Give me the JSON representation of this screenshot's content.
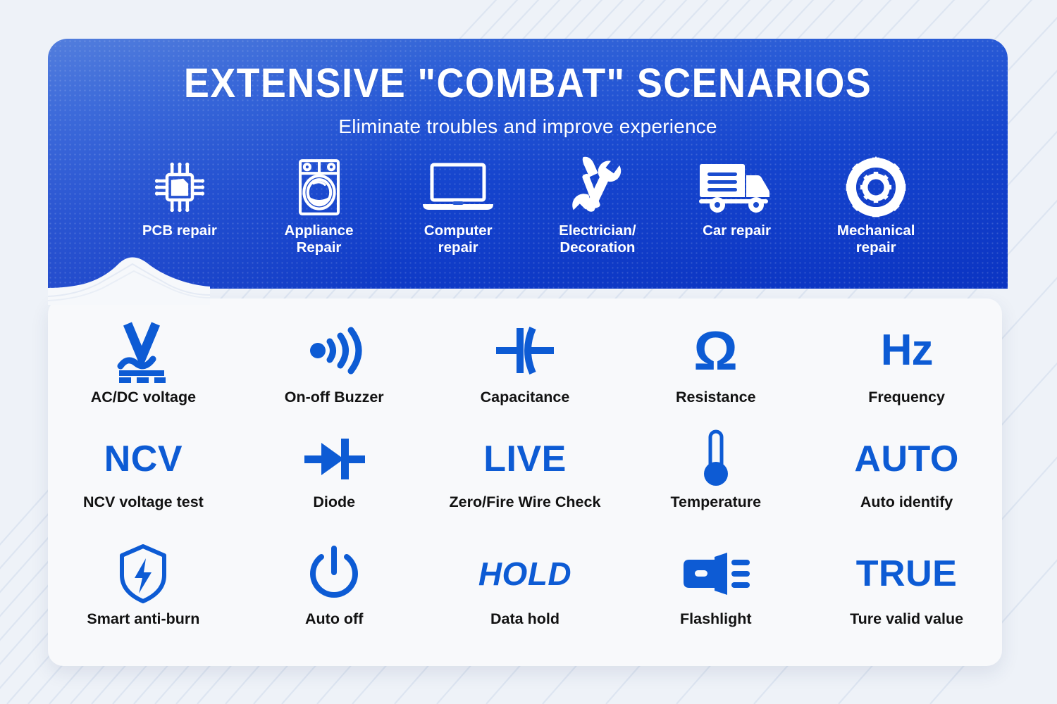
{
  "header": {
    "title": "EXTENSIVE \"COMBAT\" SCENARIOS",
    "subtitle": "Eliminate troubles and improve experience",
    "bg_color_top": "#3f6fd9",
    "bg_color_bottom": "#0b34c2",
    "text_color": "#ffffff",
    "scenarios": [
      {
        "icon": "pcb-chip-icon",
        "label": "PCB repair"
      },
      {
        "icon": "washing-machine-icon",
        "label": "Appliance\nRepair"
      },
      {
        "icon": "laptop-icon",
        "label": "Computer\nrepair"
      },
      {
        "icon": "hammer-wrench-icon",
        "label": "Electrician/\nDecoration"
      },
      {
        "icon": "delivery-truck-icon",
        "label": "Car repair"
      },
      {
        "icon": "gear-icon",
        "label": "Mechanical\nrepair"
      }
    ]
  },
  "features": {
    "card_bg": "#f8f9fb",
    "accent_color": "#0d5bd4",
    "label_color": "#121212",
    "rows": [
      [
        {
          "icon": "ac-dc-voltage-icon",
          "icon_text": "",
          "label": "AC/DC voltage"
        },
        {
          "icon": "buzzer-icon",
          "icon_text": "",
          "label": "On-off Buzzer"
        },
        {
          "icon": "capacitor-icon",
          "icon_text": "",
          "label": "Capacitance"
        },
        {
          "icon": "ohm-icon",
          "icon_text": "Ω",
          "label": "Resistance"
        },
        {
          "icon": "hz-icon",
          "icon_text": "Hz",
          "label": "Frequency"
        }
      ],
      [
        {
          "icon": "ncv-icon",
          "icon_text": "NCV",
          "label": "NCV voltage test"
        },
        {
          "icon": "diode-icon",
          "icon_text": "",
          "label": "Diode"
        },
        {
          "icon": "live-icon",
          "icon_text": "LIVE",
          "label": "Zero/Fire Wire Check"
        },
        {
          "icon": "thermometer-icon",
          "icon_text": "",
          "label": "Temperature"
        },
        {
          "icon": "auto-icon",
          "icon_text": "AUTO",
          "label": "Auto identify"
        }
      ],
      [
        {
          "icon": "shield-bolt-icon",
          "icon_text": "",
          "label": "Smart anti-burn"
        },
        {
          "icon": "power-icon",
          "icon_text": "",
          "label": "Auto off"
        },
        {
          "icon": "hold-icon",
          "icon_text": "HOLD",
          "label": "Data hold"
        },
        {
          "icon": "flashlight-icon",
          "icon_text": "",
          "label": "Flashlight"
        },
        {
          "icon": "true-icon",
          "icon_text": "TRUE",
          "label": "Ture valid value"
        }
      ]
    ]
  }
}
